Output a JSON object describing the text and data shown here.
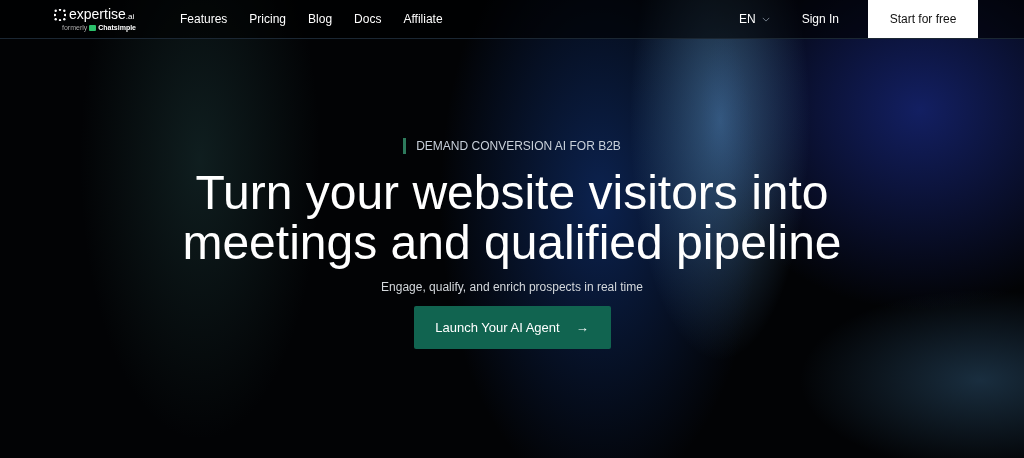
{
  "nav": {
    "logo": {
      "name": "expertise",
      "suffix": ".ai",
      "formerly": "formerly",
      "former_name": "Chatsimple"
    },
    "links": [
      {
        "label": "Features"
      },
      {
        "label": "Pricing"
      },
      {
        "label": "Blog"
      },
      {
        "label": "Docs"
      },
      {
        "label": "Affiliate"
      }
    ],
    "language": "EN",
    "sign_in": "Sign In",
    "cta": "Start for free"
  },
  "hero": {
    "eyebrow": "DEMAND CONVERSION AI FOR B2B",
    "title": "Turn your website visitors into meetings and qualified pipeline",
    "subtitle": "Engage, qualify, and enrich prospects in real time",
    "button": {
      "label": "Launch Your AI Agent",
      "arrow": "→"
    }
  }
}
